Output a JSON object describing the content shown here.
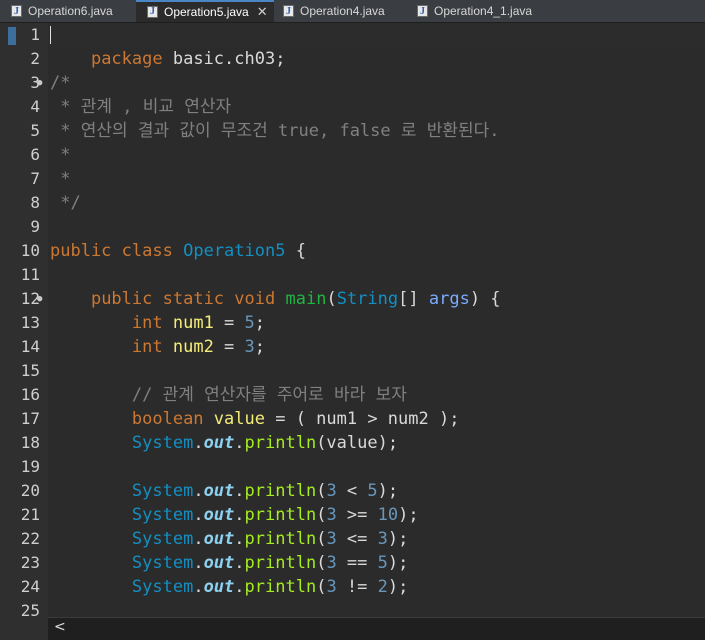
{
  "tabs": [
    {
      "label": "Operation6.java",
      "active": false
    },
    {
      "label": "Operation5.java",
      "active": true,
      "close": "✕"
    },
    {
      "label": "Operation4.java",
      "active": false
    },
    {
      "label": "Operation4_1.java",
      "active": false
    }
  ],
  "editor": {
    "line_numbers": [
      "1",
      "2",
      "3",
      "4",
      "5",
      "6",
      "7",
      "8",
      "9",
      "10",
      "11",
      "12",
      "13",
      "14",
      "15",
      "16",
      "17",
      "18",
      "19",
      "20",
      "21",
      "22",
      "23",
      "24",
      "25"
    ],
    "fold_markers": {
      "line_3": "●",
      "line_12": "●"
    },
    "code": {
      "l1": {
        "kw": "package",
        "rest": " basic.ch03;"
      },
      "l3": "/*",
      "l4": " * 관계 , 비교 연산자",
      "l5": " * 연산의 결과 값이 무조건 true, false 로 반환된다.",
      "l6": " *",
      "l7": " *",
      "l8": " */",
      "l10": {
        "kw1": "public",
        "kw2": "class",
        "name": "Operation5",
        "brace": "{"
      },
      "l12": {
        "kw1": "public",
        "kw2": "static",
        "kw3": "void",
        "method": "main",
        "ptype": "String",
        "arr": "[]",
        "param": "args",
        "close": ") {",
        "open": "("
      },
      "l13": {
        "type": "int",
        "var": "num1",
        "op": " = ",
        "val": "5",
        "end": ";"
      },
      "l14": {
        "type": "int",
        "var": "num2",
        "op": " = ",
        "val": "3",
        "end": ";"
      },
      "l16": "// 관계 연산자를 주어로 바라 보자",
      "l17": {
        "type": "boolean",
        "var": "value",
        "rest": " = ( num1 > num2 );"
      },
      "l18": {
        "sys": "System",
        "dot1": ".",
        "field": "out",
        "dot2": ".",
        "call": "println",
        "args": "(value);"
      },
      "l20": {
        "sys": "System",
        "field": "out",
        "call": "println",
        "a": "(",
        "n1": "3",
        "op": " < ",
        "n2": "5",
        "end": ");"
      },
      "l21": {
        "sys": "System",
        "field": "out",
        "call": "println",
        "a": "(",
        "n1": "3",
        "op": " >= ",
        "n2": "10",
        "end": ");"
      },
      "l22": {
        "sys": "System",
        "field": "out",
        "call": "println",
        "a": "(",
        "n1": "3",
        "op": " <= ",
        "n2": "3",
        "end": ");"
      },
      "l23": {
        "sys": "System",
        "field": "out",
        "call": "println",
        "a": "(",
        "n1": "3",
        "op": " == ",
        "n2": "5",
        "end": ");"
      },
      "l24": {
        "sys": "System",
        "field": "out",
        "call": "println",
        "a": "(",
        "n1": "3",
        "op": " != ",
        "n2": "2",
        "end": ");"
      }
    }
  },
  "scrollbar": {
    "left_arrow": "<"
  },
  "colors": {
    "background": "#2b2b2b",
    "keyword": "#cc7832",
    "class": "#1290c3",
    "method": "#1eb540",
    "comment": "#808080",
    "number": "#6897bb",
    "variable": "#f3ec79"
  }
}
